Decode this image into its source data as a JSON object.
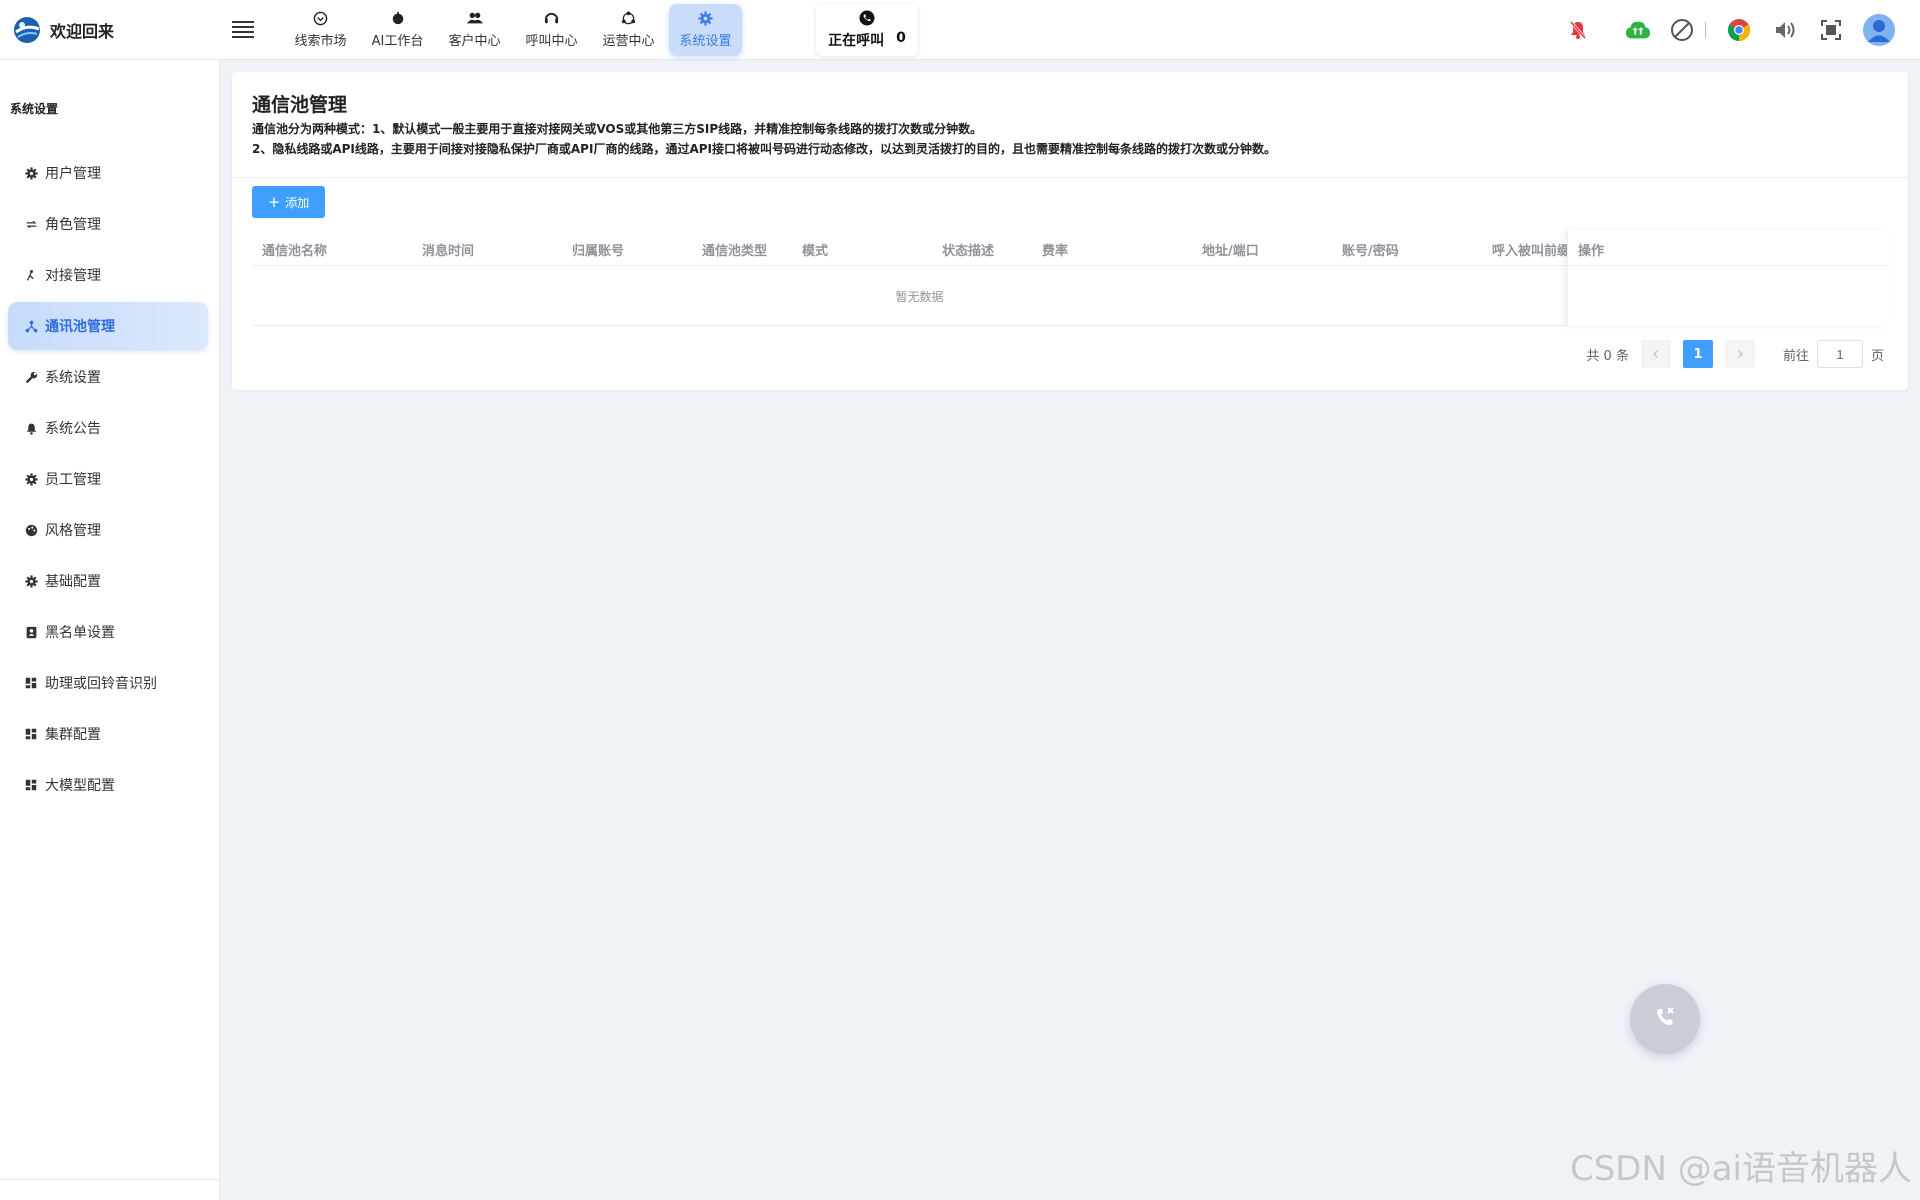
{
  "header": {
    "brand": "欢迎回来",
    "nav": [
      {
        "label": "线索市场",
        "icon": "clue-icon"
      },
      {
        "label": "AI工作台",
        "icon": "robot-icon"
      },
      {
        "label": "客户中心",
        "icon": "users-icon"
      },
      {
        "label": "呼叫中心",
        "icon": "headset-icon"
      },
      {
        "label": "运营中心",
        "icon": "operation-icon"
      },
      {
        "label": "系统设置",
        "icon": "gear-icon",
        "active": true
      }
    ],
    "calling_label": "正在呼叫",
    "calling_count": "0"
  },
  "sidebar": {
    "section_title": "系统设置",
    "items": [
      {
        "label": "用户管理",
        "icon": "gear-icon"
      },
      {
        "label": "角色管理",
        "icon": "swap-icon"
      },
      {
        "label": "对接管理",
        "icon": "connect-icon"
      },
      {
        "label": "通讯池管理",
        "icon": "network-icon",
        "active": true
      },
      {
        "label": "系统设置",
        "icon": "wrench-icon"
      },
      {
        "label": "系统公告",
        "icon": "bell-icon"
      },
      {
        "label": "员工管理",
        "icon": "gear-icon"
      },
      {
        "label": "风格管理",
        "icon": "palette-icon"
      },
      {
        "label": "基础配置",
        "icon": "gear-icon"
      },
      {
        "label": "黑名单设置",
        "icon": "contact-book-icon"
      },
      {
        "label": "助理或回铃音识别",
        "icon": "dashboard-icon"
      },
      {
        "label": "集群配置",
        "icon": "dashboard-icon"
      },
      {
        "label": "大模型配置",
        "icon": "dashboard-icon"
      }
    ]
  },
  "main": {
    "title": "通信池管理",
    "desc_line1": "通信池分为两种模式：1、默认模式一般主要用于直接对接网关或VOS或其他第三方SIP线路，并精准控制每条线路的拨打次数或分钟数。",
    "desc_line2": "2、隐私线路或API线路，主要用于间接对接隐私保护厂商或API厂商的线路，通过API接口将被叫号码进行动态修改，以达到灵活拨打的目的，且也需要精准控制每条线路的拨打次数或分钟数。",
    "add_label": "添加",
    "columns": [
      "通信池名称",
      "消息时间",
      "归属账号",
      "通信池类型",
      "模式",
      "状态描述",
      "费率",
      "地址/端口",
      "账号/密码",
      "呼入被叫前缀"
    ],
    "action_column": "操作",
    "empty_text": "暂无数据",
    "pagination": {
      "total_text": "共 0 条",
      "current_page": "1",
      "goto_label": "前往",
      "goto_value": "1",
      "page_suffix": "页"
    }
  },
  "watermark": "CSDN @ai语音机器人",
  "colors": {
    "primary": "#409eff",
    "active_nav_bg": "#c9ddfb",
    "page_bg": "#eff3f8"
  }
}
